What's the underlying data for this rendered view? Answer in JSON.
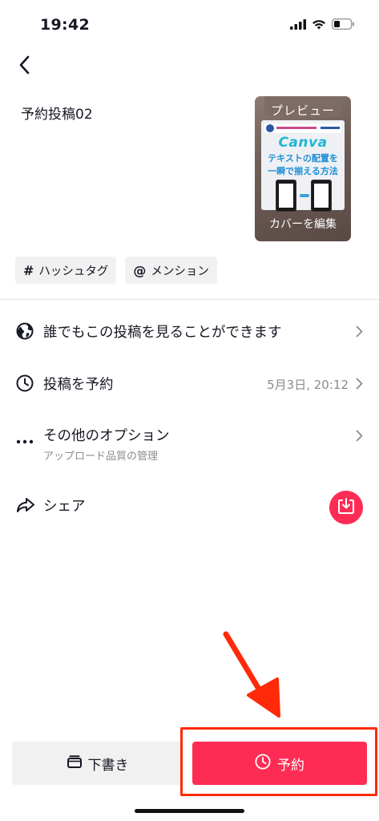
{
  "status_bar": {
    "time": "19:42"
  },
  "caption": "予約投稿02",
  "cover": {
    "preview_label": "プレビュー",
    "headline_word": "Canva",
    "headline_line1": "テキストの配置を",
    "headline_line2": "一瞬で揃える方法",
    "edit_label": "カバーを編集"
  },
  "chips": [
    {
      "symbol": "#",
      "label": "ハッシュタグ"
    },
    {
      "symbol": "@",
      "label": "メンション"
    }
  ],
  "rows": {
    "privacy": {
      "label": "誰でもこの投稿を見ることができます"
    },
    "schedule": {
      "label": "投稿を予約",
      "value": "5月3日, 20:12"
    },
    "more": {
      "label": "その他のオプション",
      "sub": "アップロード品質の管理"
    },
    "share": {
      "label": "シェア"
    }
  },
  "buttons": {
    "draft": "下書き",
    "schedule": "予約"
  },
  "colors": {
    "accent": "#fe2c55",
    "annotation": "#ff2a0a",
    "muted_text": "#8a8b91",
    "chip_bg": "#f1f1f2"
  }
}
